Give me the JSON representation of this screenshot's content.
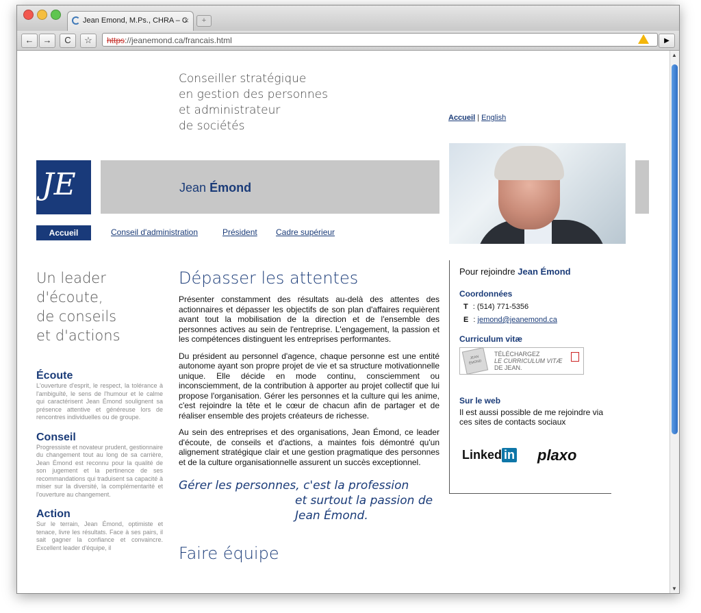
{
  "browser": {
    "tab_title": "Jean Emond, M.Ps., CHRA – C",
    "tab_close": "×",
    "new_tab": "+",
    "url_scheme": "https",
    "url_rest": "://jeanemond.ca/francais.html",
    "back": "←",
    "forward": "→",
    "reload": "C",
    "bookmark": "☆",
    "page_menu": "▶"
  },
  "header": {
    "tagline": [
      "Conseiller stratégique",
      "en gestion des personnes",
      "et administrateur",
      "de sociétés"
    ],
    "lang_current": "Accueil",
    "lang_sep": "|",
    "lang_other": "English",
    "logo_text": "JE",
    "name_first": "Jean",
    "name_last": "Émond"
  },
  "nav": {
    "items": [
      "Accueil",
      "Conseil d'administration",
      "Président",
      "Cadre supérieur"
    ]
  },
  "left": {
    "lead": [
      "Un leader",
      "d'écoute,",
      "de conseils",
      "et d'actions"
    ],
    "sections": [
      {
        "title": "Écoute",
        "text": "L'ouverture d'esprit, le respect, la tolérance à l'ambiguïté, le sens de l'humour et le calme qui caractérisent Jean Émond soulignent sa présence attentive et généreuse lors de rencontres individuelles ou de groupe."
      },
      {
        "title": "Conseil",
        "text": "Progressiste et novateur prudent, gestionnaire du changement tout au long de sa carrière, Jean Émond est reconnu pour la qualité de son jugement et la pertinence de ses recommandations qui traduisent sa capacité à miser sur la diversité, la complémentarité et l'ouverture au changement."
      },
      {
        "title": "Action",
        "text": "Sur le terrain, Jean Émond, optimiste et tenace, livre les résultats. Face à ses pairs, il sait gagner la confiance et convaincre. Excellent leader d'équipe, il"
      }
    ]
  },
  "main": {
    "h1": "Dépasser les attentes",
    "paragraphs": [
      "Présenter constamment des résultats au-delà des attentes des actionnaires et dépasser les objectifs de son plan d'affaires requièrent avant tout la mobilisation de la direction et de l'ensemble des personnes actives au sein de l'entreprise. L'engagement, la passion et les compétences distinguent les entreprises performantes.",
      "Du président au personnel d'agence, chaque personne est une entité autonome ayant son propre projet de vie et sa structure motivationnelle unique. Elle décide en mode continu, consciemment ou inconsciemment, de la contribution à apporter au projet collectif que lui propose l'organisation. Gérer les personnes et la culture qui les anime, c'est rejoindre la tête et le cœur de chacun afin de partager et de réaliser ensemble des projets créateurs de richesse.",
      "Au sein des entreprises et des organisations, Jean Émond, ce leader d'écoute, de conseils et d'actions, a maintes fois démontré qu'un alignement stratégique clair et une gestion pragmatique des personnes et de la culture organisationnelle assurent un succès exceptionnel."
    ],
    "quote_line1": "Gérer les personnes, c'est la profession",
    "quote_line2": "et surtout la passion de Jean Émond.",
    "h2": "Faire équipe"
  },
  "sidebar": {
    "title_prefix": "Pour rejoindre",
    "title_name": "Jean Émond",
    "coord_title": "Coordonnées",
    "phone_label": "T",
    "phone": ": (514) 771-5356",
    "email_label": "E",
    "email_sep": ":",
    "email": "jemond@jeanemond.ca",
    "cv_title": "Curriculum vitæ",
    "cv_thumb": "JEAN ÉMOND",
    "cv_line1": "TÉLÉCHARGEZ",
    "cv_line2": "LE CURRICULUM VITÆ",
    "cv_line3": "DE JEAN.",
    "web_title": "Sur le web",
    "web_text": "Il est aussi possible de me rejoindre via ces sites de contacts sociaux",
    "linkedin_a": "Linked",
    "linkedin_b": "in",
    "plaxo": "plaxo"
  },
  "colors": {
    "navy": "#193a7a",
    "grey_bar": "#c7c7c7"
  }
}
